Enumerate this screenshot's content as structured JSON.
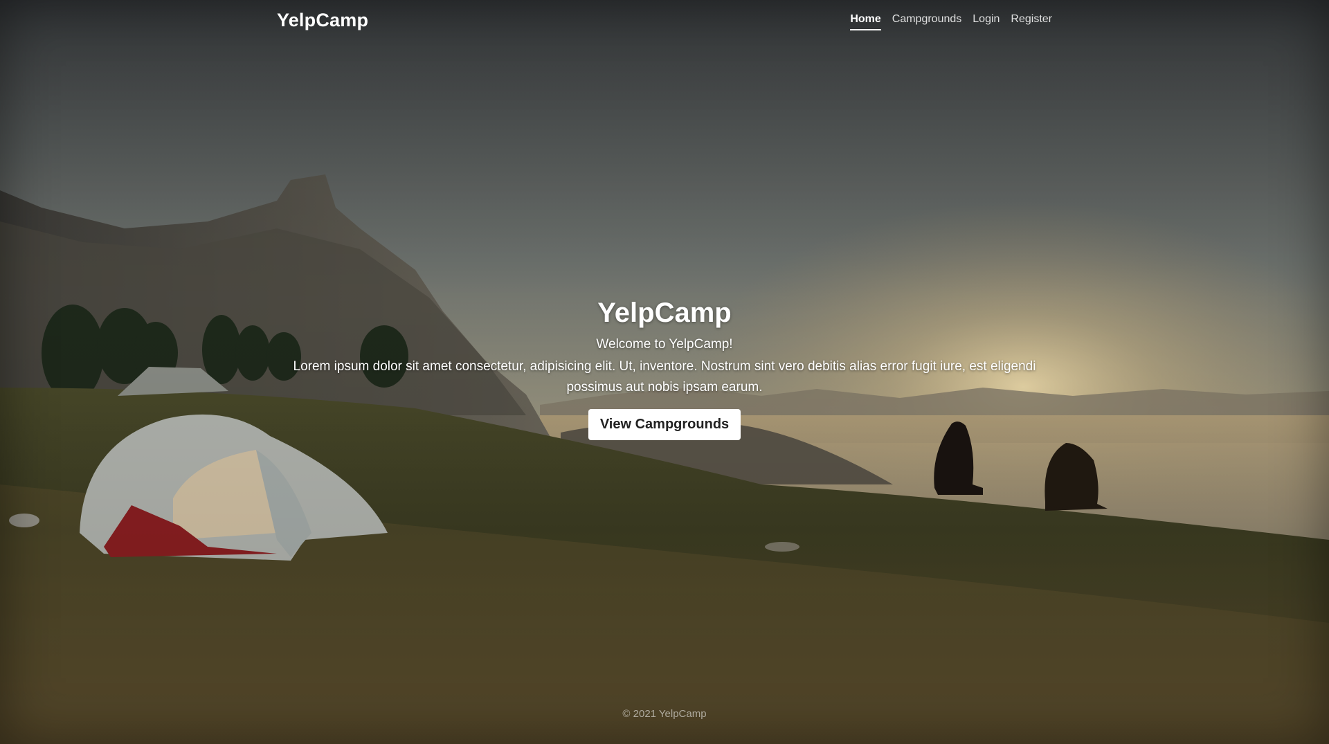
{
  "nav": {
    "brand": "YelpCamp",
    "links": [
      {
        "label": "Home",
        "active": true
      },
      {
        "label": "Campgrounds"
      },
      {
        "label": "Login"
      },
      {
        "label": "Register"
      }
    ]
  },
  "hero": {
    "title": "YelpCamp",
    "welcome": "Welcome to YelpCamp!",
    "lead": "Lorem ipsum dolor sit amet consectetur, adipisicing elit. Ut, inventore. Nostrum sint vero debitis alias error fugit iure, est eligendi possimus aut nobis ipsam earum.",
    "button_label": "View Campgrounds"
  },
  "footer": {
    "text": "© 2021 YelpCamp"
  },
  "colors": {
    "text": "#ffffff",
    "button_bg": "#ffffff",
    "button_text": "#222222"
  }
}
